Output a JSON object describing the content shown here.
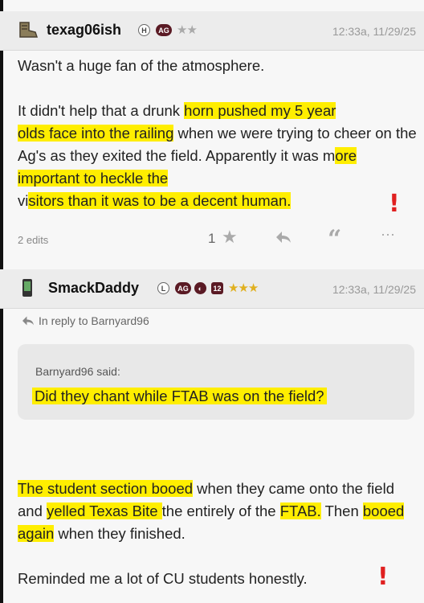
{
  "post1": {
    "username": "texag06ish",
    "badge_h": "H",
    "badge_ag": "AG",
    "stars": "★★",
    "timestamp": "12:33a, 11/29/25",
    "line1": "Wasn't a huge fan of the atmosphere.",
    "p2a": "It didn't help that a drunk ",
    "p2b": "horn pushed my 5 year",
    "p2c": "olds face into the railing",
    "p2d": " when we were trying to cheer on the Ag's as they exited the field. Apparently it was m",
    "p2e": "ore important to heckle the",
    "p2f": "vi",
    "p2g": "sitors than it was to be a decent human.",
    "edits": "2 edits",
    "likes": "1",
    "icon_names": [
      "star-icon",
      "reply-arrow-icon",
      "quote-icon",
      "more-icon"
    ]
  },
  "post2": {
    "username": "SmackDaddy",
    "badge_l": "L",
    "badge_ag": "AG",
    "badge_12": "12",
    "stars": "★★★",
    "timestamp": "12:33a, 11/29/25",
    "reply_to": "In reply to Barnyard96",
    "quote_author": "Barnyard96 said:",
    "quote_text": "Did they chant while FTAB was on the field?",
    "p1a": "The student section booed",
    "p1b": " when they came onto the field and ",
    "p1c": "yelled Texas Bite ",
    "p1d": "the entirely of the ",
    "p1e": "FTAB.",
    "p1f": " Then ",
    "p1g": "booed again",
    "p1h": " when they finished.",
    "p2": "Reminded me a lot of CU students honestly."
  },
  "colors": {
    "highlight": "#ffee00",
    "maroon": "#5a1a24",
    "annotation": "#e02020"
  }
}
